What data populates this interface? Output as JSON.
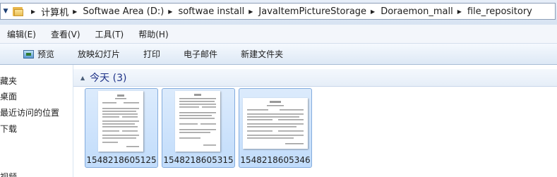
{
  "address_bar": {
    "breadcrumbs": [
      "计算机",
      "Softwae Area (D:)",
      "softwae install",
      "JavaItemPictureStorage",
      "Doraemon_mall",
      "file_repository"
    ]
  },
  "menu": {
    "items": [
      "编辑(E)",
      "查看(V)",
      "工具(T)",
      "帮助(H)"
    ]
  },
  "command_bar": {
    "items": [
      {
        "label": "预览",
        "icon": "preview-icon"
      },
      {
        "label": "放映幻灯片"
      },
      {
        "label": "打印"
      },
      {
        "label": "电子邮件"
      },
      {
        "label": "新建文件夹"
      }
    ]
  },
  "nav_pane": {
    "items": [
      "藏夹",
      "桌面",
      "最近访问的位置",
      "下载"
    ],
    "partial_item": "视频"
  },
  "content": {
    "group_title": "今天 (3)",
    "files": [
      {
        "name": "1548218605125"
      },
      {
        "name": "1548218605315"
      },
      {
        "name": "1548218605346"
      }
    ]
  },
  "colors": {
    "selection_fill": "#c9e0fb",
    "selection_border": "#84acdd",
    "group_title": "#1e3287"
  }
}
